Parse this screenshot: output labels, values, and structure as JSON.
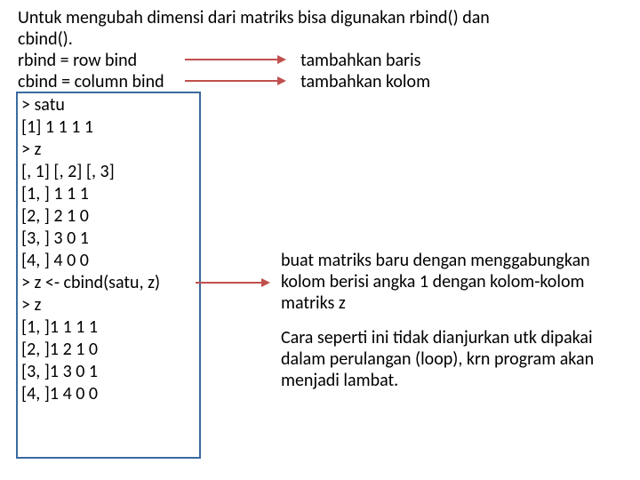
{
  "intro_l1": "Untuk mengubah dimensi dari matriks bisa digunakan rbind() dan",
  "intro_l2": "cbind().",
  "rbind_def": "rbind = row bind",
  "rbind_res": "tambahkan baris",
  "cbind_def": "cbind = column bind",
  "cbind_res": "tambahkan kolom",
  "code": {
    "l1": "> satu",
    "l2": "[1] 1 1 1 1",
    "l3": "> z",
    "l4": "[, 1] [, 2] [, 3]",
    "l5": "[1, ] 1 1 1",
    "l6": "[2, ] 2 1 0",
    "l7": "[3, ] 3 0 1",
    "l8": "[4, ] 4 0 0",
    "l9": "> z <- cbind(satu, z)",
    "l10": "> z",
    "l11": "[1, ]1 1 1 1",
    "l12": "[2, ]1 2 1 0",
    "l13": "[3, ]1 3 0 1",
    "l14": "[4, ]1 4 0 0"
  },
  "note_cbind": "buat matriks baru dengan menggabungkan kolom berisi angka 1 dengan kolom-kolom matriks z",
  "note_perf": "Cara seperti ini tidak dianjurkan utk dipakai dalam perulangan (loop), krn program akan menjadi lambat."
}
